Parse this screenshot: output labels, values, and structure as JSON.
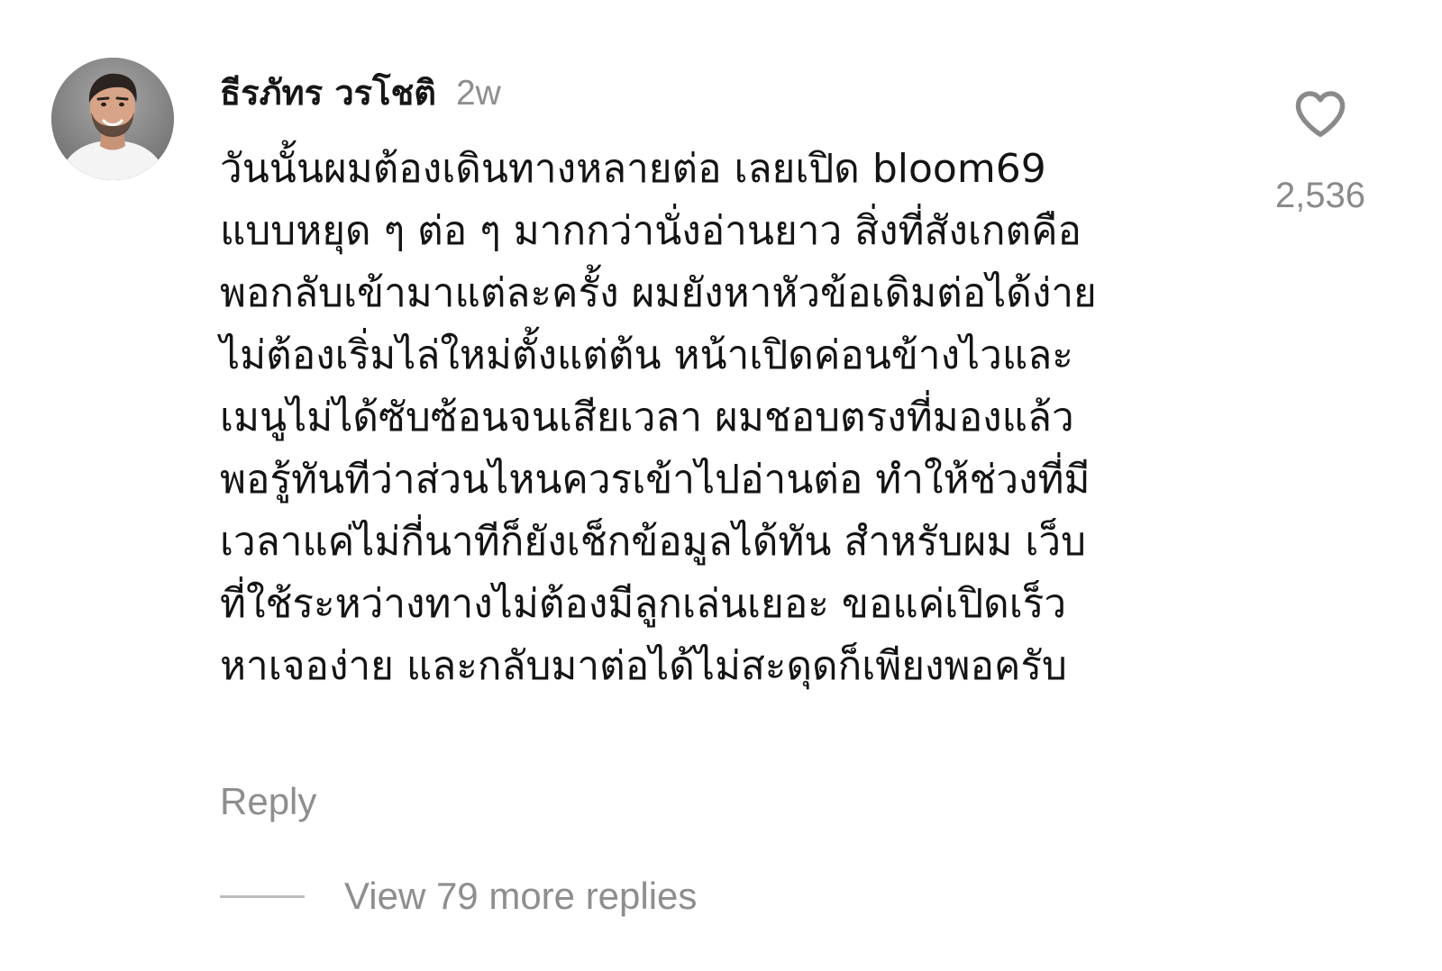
{
  "comment": {
    "username": "ธีรภัทร วรโชติ",
    "timestamp": "2w",
    "body_lines": [
      "วันนั้นผมต้องเดินทางหลายต่อ เลยเปิด bloom69",
      "แบบหยุด ๆ ต่อ ๆ มากกว่านั่งอ่านยาว สิ่งที่สังเกตคือ",
      "พอกลับเข้ามาแต่ละครั้ง ผมยังหาหัวข้อเดิมต่อได้ง่าย",
      "ไม่ต้องเริ่มไล่ใหม่ตั้งแต่ต้น หน้าเปิดค่อนข้างไวและ",
      "เมนูไม่ได้ซับซ้อนจนเสียเวลา ผมชอบตรงที่มองแล้ว",
      "พอรู้ทันทีว่าส่วนไหนควรเข้าไปอ่านต่อ ทำให้ช่วงที่มี",
      "เวลาแค่ไม่กี่นาทีก็ยังเช็กข้อมูลได้ทัน สำหรับผม เว็บ",
      "ที่ใช้ระหว่างทางไม่ต้องมีลูกเล่นเยอะ ขอแค่เปิดเร็ว",
      "หาเจอง่าย และกลับมาต่อได้ไม่สะดุดก็เพียงพอครับ"
    ],
    "like_icon": "heart-outline-icon",
    "like_count": "2,536",
    "reply_label": "Reply",
    "view_replies_label": "View 79 more replies"
  },
  "colors": {
    "background": "#ffffff",
    "text": "#141414",
    "muted": "#8e8e8e",
    "divider": "#bdbdbd"
  }
}
